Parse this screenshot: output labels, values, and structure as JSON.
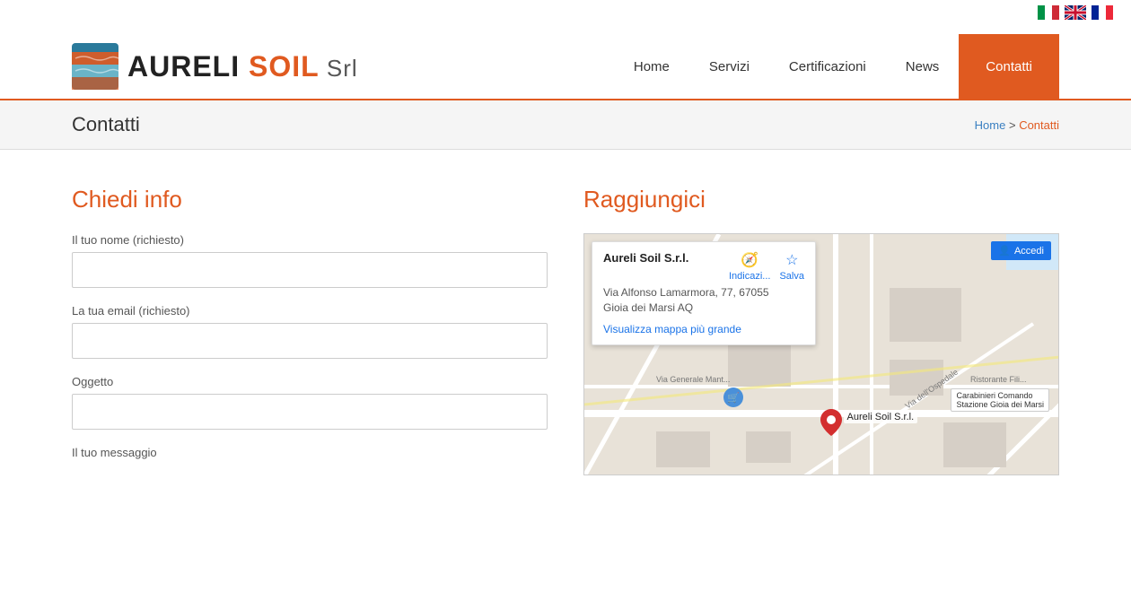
{
  "lang_bar": {
    "flags": [
      {
        "name": "italian",
        "title": "Italiano"
      },
      {
        "name": "english",
        "title": "English"
      },
      {
        "name": "french",
        "title": "Français"
      }
    ]
  },
  "header": {
    "logo_brand": "AURELI ",
    "logo_soil": "SOIL",
    "logo_srl": " Srl",
    "nav_items": [
      {
        "label": "Home",
        "active": false
      },
      {
        "label": "Servizi",
        "active": false
      },
      {
        "label": "Certificazioni",
        "active": false
      },
      {
        "label": "News",
        "active": false
      },
      {
        "label": "Contatti",
        "active": true
      }
    ]
  },
  "breadcrumb": {
    "title": "Contatti",
    "home_label": "Home",
    "separator": " > ",
    "current": "Contatti"
  },
  "form": {
    "title": "Chiedi info",
    "fields": [
      {
        "id": "nome",
        "label": "Il tuo nome (richiesto)",
        "type": "text",
        "placeholder": ""
      },
      {
        "id": "email",
        "label": "La tua email (richiesto)",
        "type": "email",
        "placeholder": ""
      },
      {
        "id": "oggetto",
        "label": "Oggetto",
        "type": "text",
        "placeholder": ""
      },
      {
        "id": "messaggio",
        "label": "Il tuo messaggio",
        "type": "textarea",
        "placeholder": ""
      }
    ]
  },
  "map": {
    "title": "Raggiungici",
    "card": {
      "name": "Aureli Soil S.r.l.",
      "address_line1": "Via Alfonso Lamarmora, 77, 67055",
      "address_line2": "Gioia dei Marsi AQ",
      "link_label": "Visualizza mappa più grande",
      "action_directions": "Indicazi...",
      "action_save": "Salva",
      "accedi_label": "Accedi"
    },
    "pin_label": "Aureli Soil S.r.l.",
    "poi": {
      "name": "Carabinieri Comando\nStazione Gioia dei Marsi"
    }
  }
}
